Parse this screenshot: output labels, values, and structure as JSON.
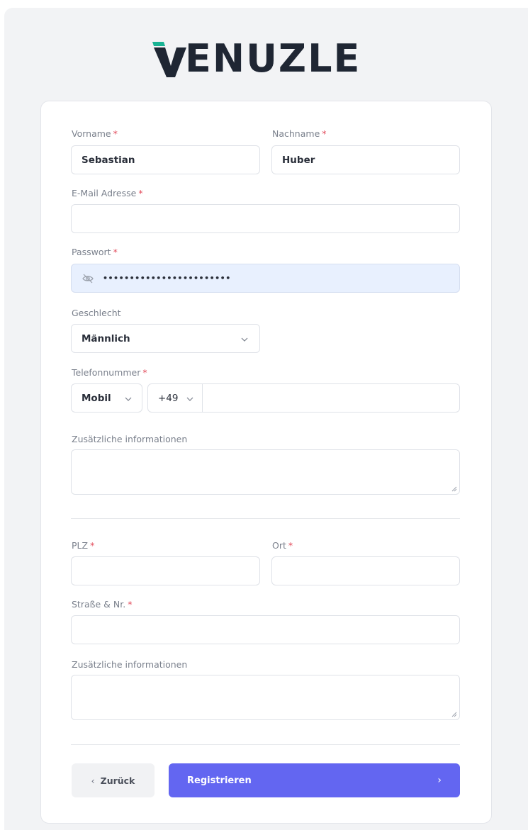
{
  "brand": {
    "logo_text": "ENUZLE",
    "colors": {
      "logo_accent": "#19b394",
      "logo_dark": "#1f2633",
      "primary": "#6366f1",
      "required": "#e24b5b"
    }
  },
  "form": {
    "first_name": {
      "label": "Vorname",
      "required": "*",
      "value": "Sebastian"
    },
    "last_name": {
      "label": "Nachname",
      "required": "*",
      "value": "Huber"
    },
    "email": {
      "label": "E-Mail Adresse",
      "required": "*",
      "value": ""
    },
    "password": {
      "label": "Passwort",
      "required": "*",
      "value": "••••••••••••••••••••••••",
      "icon": "eye-off-icon"
    },
    "gender": {
      "label": "Geschlecht",
      "value": "Männlich",
      "icon": "chevron-down-icon"
    },
    "phone": {
      "label": "Telefonnummer",
      "required": "*",
      "type_value": "Mobil",
      "country_code": "+49",
      "number": ""
    },
    "additional_info_1": {
      "label": "Zusätzliche informationen",
      "value": ""
    },
    "zip": {
      "label": "PLZ",
      "required": "*",
      "value": ""
    },
    "city": {
      "label": "Ort",
      "required": "*",
      "value": ""
    },
    "street": {
      "label": "Straße & Nr.",
      "required": "*",
      "value": ""
    },
    "additional_info_2": {
      "label": "Zusätzliche informationen",
      "value": ""
    }
  },
  "actions": {
    "back_label": "Zurück",
    "back_icon": "‹",
    "submit_label": "Registrieren",
    "submit_icon": "›"
  }
}
